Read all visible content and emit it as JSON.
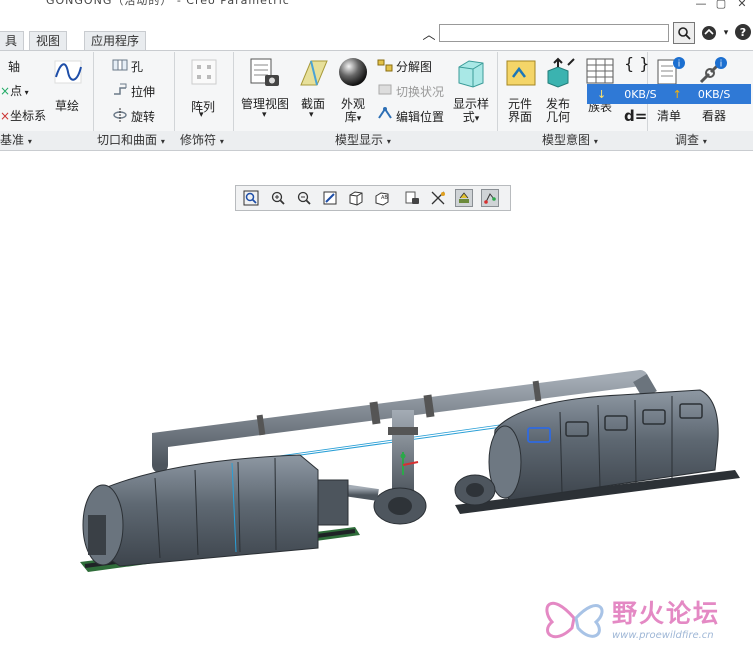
{
  "window": {
    "title": "GONGONG（活动的） - Creo Parametric"
  },
  "search": {
    "placeholder": ""
  },
  "tabs": [
    {
      "label": "具"
    },
    {
      "label": "视图"
    },
    {
      "label": "应用程序"
    }
  ],
  "ribbon": {
    "datum": {
      "axis": "轴",
      "point": "点",
      "csys": "坐标系",
      "sketch": "草绘"
    },
    "cut": {
      "hole": "孔",
      "extrude": "拉伸",
      "revolve": "旋转"
    },
    "modifiers": {
      "pattern": "阵列"
    },
    "model_display": {
      "manage_views": "管理视图",
      "section": "截面",
      "appearance_line1": "外观",
      "appearance_line2": "库",
      "exploded": "分解图",
      "toggle_status": "切换状况",
      "edit_position": "编辑位置",
      "display_style_line1": "显示样",
      "display_style_line2": "式"
    },
    "model_intent": {
      "component_ui_line1": "元件",
      "component_ui_line2": "界面",
      "publish_geom_line1": "发布",
      "publish_geom_line2": "几何",
      "table": "族表",
      "switch_d": "d="
    },
    "investigate": {
      "bom_line2": "清单",
      "ref_viewer_line2": "看器"
    }
  },
  "groups": {
    "datum": "基准",
    "cut_surface": "切口和曲面",
    "modifiers": "修饰符",
    "model_display": "模型显示",
    "model_intent": "模型意图",
    "investigate": "调查"
  },
  "net_monitor": {
    "down": "0KB/S",
    "up": "0KB/S"
  },
  "watermark": {
    "name": "野火论坛",
    "url": "www.proewildfire.cn"
  },
  "colors": {
    "accent": "#2f79d6",
    "model": "#5c6773",
    "watermark": "#e489c4"
  }
}
